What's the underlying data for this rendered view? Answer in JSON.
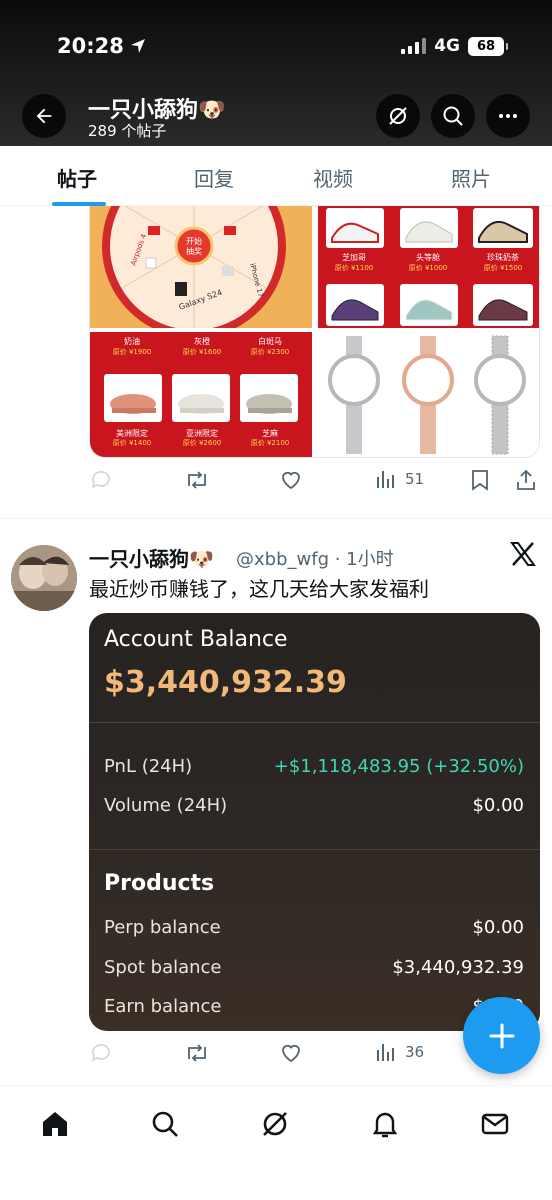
{
  "status_bar": {
    "time": "20:28",
    "network": "4G",
    "battery": "68"
  },
  "profile": {
    "name": "一只小舔狗🐶",
    "post_count": "289 个帖子"
  },
  "tabs": [
    {
      "label": "帖子",
      "active": true
    },
    {
      "label": "回复",
      "active": false
    },
    {
      "label": "视频",
      "active": false
    },
    {
      "label": "照片",
      "active": false
    }
  ],
  "post1": {
    "wheel_center": "开始\n抽奖",
    "wheel_labels": [
      "Airpods 4",
      "Galaxy S24",
      "iPhone 17"
    ],
    "shoes_left": [
      {
        "name": "奶油",
        "price": "原价 ¥1900"
      },
      {
        "name": "灰橙",
        "price": "原价 ¥1600"
      },
      {
        "name": "白斑马",
        "price": "原价 ¥2300"
      },
      {
        "name": "美洲限定",
        "price": "原价 ¥1400"
      },
      {
        "name": "亚洲限定",
        "price": "原价 ¥2600"
      },
      {
        "name": "芝麻",
        "price": "原价 ¥2100"
      }
    ],
    "shoes_right": [
      {
        "name": "芝加哥",
        "price": "原价 ¥1100"
      },
      {
        "name": "头等舱",
        "price": "原价 ¥1000"
      },
      {
        "name": "珍珠奶茶",
        "price": "原价 ¥1500"
      }
    ],
    "stats": {
      "views": "51"
    }
  },
  "post2": {
    "author": "一只小舔狗🐶",
    "handle_time": "@xbb_wfg · 1小时",
    "text": "最近炒币赚钱了，这几天给大家发福利",
    "account_card": {
      "title": "Account Balance",
      "balance": "$3,440,932.39",
      "pnl_label": "PnL (24H)",
      "pnl_value": "+$1,118,483.95 (+32.50%)",
      "volume_label": "Volume (24H)",
      "volume_value": "$0.00",
      "products_title": "Products",
      "perp_label": "Perp balance",
      "perp_value": "$0.00",
      "spot_label": "Spot balance",
      "spot_value": "$3,440,932.39",
      "earn_label": "Earn balance",
      "earn_value": "$0.00"
    },
    "stats": {
      "views": "36"
    }
  },
  "colors": {
    "accent": "#1d9bf0",
    "balance": "#f2b87a",
    "pnl": "#3dd7b4"
  }
}
